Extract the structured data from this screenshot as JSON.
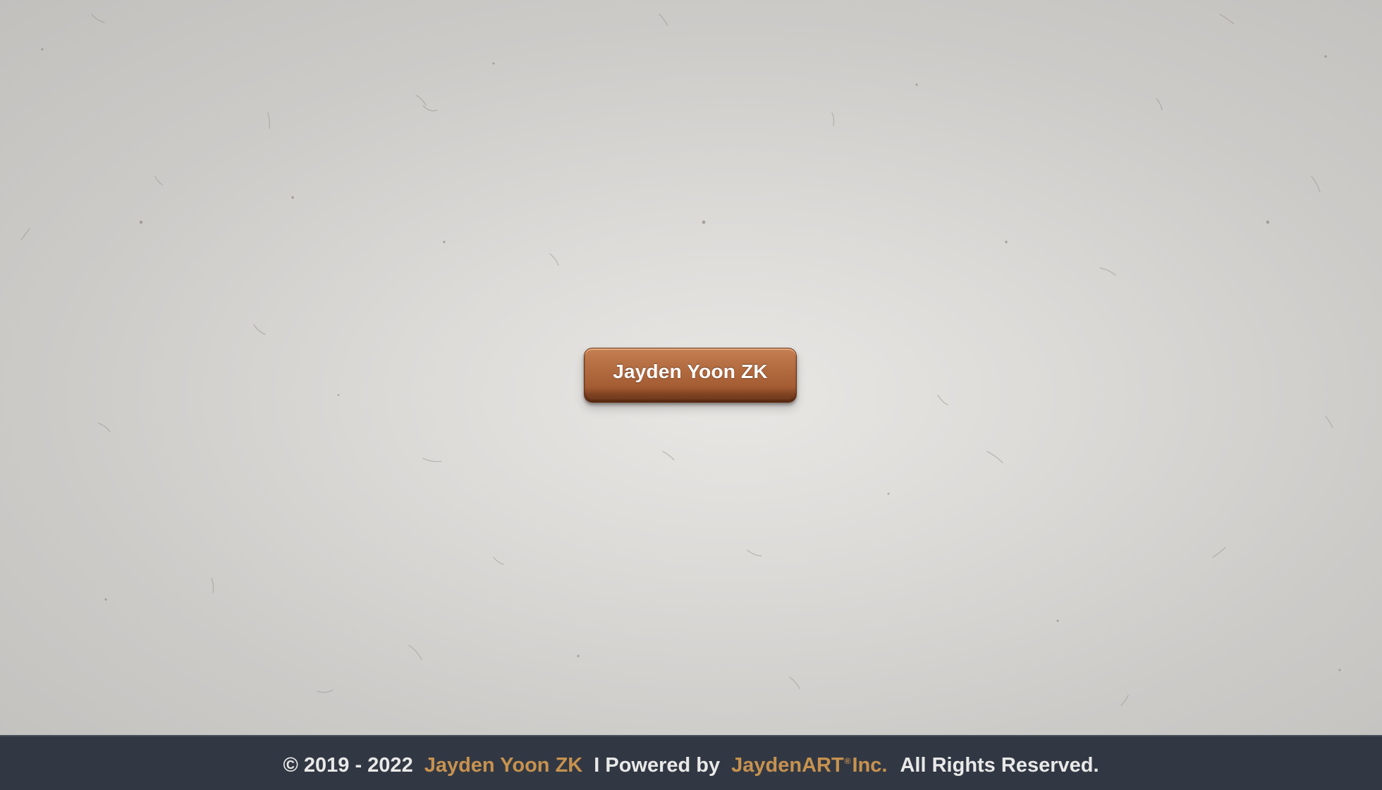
{
  "main": {
    "button_label": "Jayden Yoon ZK"
  },
  "footer": {
    "copyright": "© 2019 - 2022",
    "author": "Jayden Yoon ZK",
    "powered_by": "I Powered by",
    "company_name": "JaydenART",
    "registered_mark": "®",
    "company_suffix": "Inc.",
    "rights": "All Rights Reserved."
  },
  "colors": {
    "background": "#dddbd8",
    "button": "#b26a3f",
    "footer_background": "#323843",
    "footer_text": "#e9e9e9",
    "footer_accent": "#c7924f"
  }
}
